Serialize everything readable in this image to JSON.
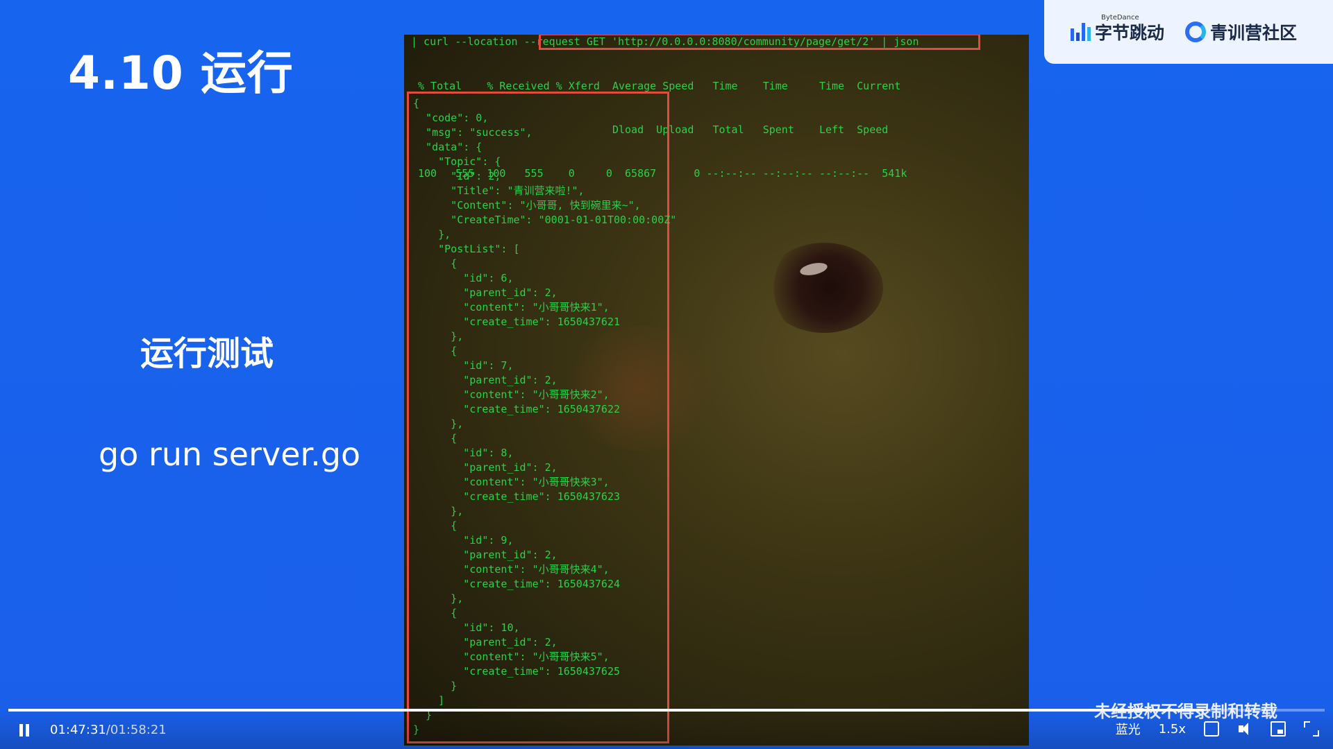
{
  "slide": {
    "title": "4.10 运行",
    "subtitle": "运行测试",
    "command": "go run server.go"
  },
  "logos": {
    "bytedance_small": "ByteDance",
    "bytedance_cn": "字节跳动",
    "community_cn": "青训营社区"
  },
  "terminal": {
    "curl_line": "| curl --location --request GET 'http://0.0.0.0:8080/community/page/get/2' | json",
    "header_line1": "% Total    % Received % Xferd  Average Speed   Time    Time     Time  Current",
    "header_line2": "                               Dload  Upload   Total   Spent    Left  Speed",
    "header_line3": "100   555  100   555    0     0  65867      0 --:--:-- --:--:-- --:--:--  541k",
    "json_output": "{\n  \"code\": 0,\n  \"msg\": \"success\",\n  \"data\": {\n    \"Topic\": {\n      \"Id\": 2,\n      \"Title\": \"青训营来啦!\",\n      \"Content\": \"小哥哥, 快到碗里来~\",\n      \"CreateTime\": \"0001-01-01T00:00:00Z\"\n    },\n    \"PostList\": [\n      {\n        \"id\": 6,\n        \"parent_id\": 2,\n        \"content\": \"小哥哥快来1\",\n        \"create_time\": 1650437621\n      },\n      {\n        \"id\": 7,\n        \"parent_id\": 2,\n        \"content\": \"小哥哥快来2\",\n        \"create_time\": 1650437622\n      },\n      {\n        \"id\": 8,\n        \"parent_id\": 2,\n        \"content\": \"小哥哥快来3\",\n        \"create_time\": 1650437623\n      },\n      {\n        \"id\": 9,\n        \"parent_id\": 2,\n        \"content\": \"小哥哥快来4\",\n        \"create_time\": 1650437624\n      },\n      {\n        \"id\": 10,\n        \"parent_id\": 2,\n        \"content\": \"小哥哥快来5\",\n        \"create_time\": 1650437625\n      }\n    ]\n  }\n}"
  },
  "overlay": {
    "copyright_notice": "未经授权不得录制和转载"
  },
  "player": {
    "current_time": "01:47:31",
    "separator": "/",
    "duration": "01:58:21",
    "progress_fraction": 0.908,
    "quality_label": "蓝光",
    "speed_label": "1.5x",
    "icons": [
      "pause-icon",
      "subtitles-icon",
      "volume-icon",
      "picture-in-picture-icon",
      "fullscreen-icon"
    ]
  }
}
